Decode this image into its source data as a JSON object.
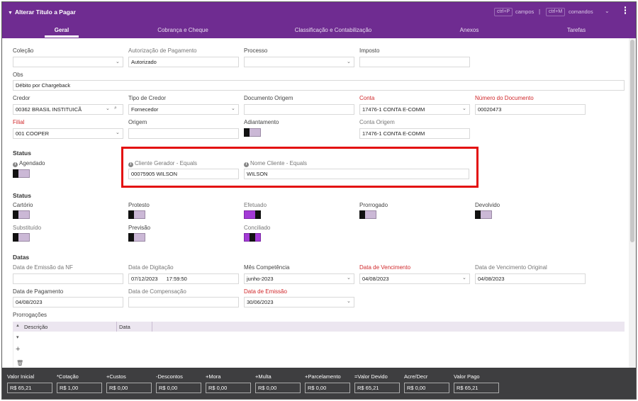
{
  "window": {
    "title": "Alterar Título a Pagar",
    "shortcut_fields_key": "ctrl+P",
    "shortcut_fields_label": "campos",
    "separator": "|",
    "shortcut_commands_key": "ctrl+M",
    "shortcut_commands_label": "comandos"
  },
  "tabs": [
    "Geral",
    "Cobrança e Cheque",
    "Classificação e Contabilização",
    "Anexos",
    "Tarefas"
  ],
  "fields": {
    "colecao": {
      "label": "Coleção",
      "value": ""
    },
    "autorizacao": {
      "label": "Autorização de Pagamento",
      "value": "Autorizado"
    },
    "processo": {
      "label": "Processo",
      "value": ""
    },
    "imposto": {
      "label": "Imposto",
      "value": ""
    },
    "obs": {
      "label": "Obs",
      "value": "Débito por Chargeback"
    },
    "credor": {
      "label": "Credor",
      "value": "00362 BRASIL INSTITUICÃ"
    },
    "tipo_credor": {
      "label": "Tipo de Credor",
      "value": "Fornecedor"
    },
    "documento_origem": {
      "label": "Documento Origem",
      "value": ""
    },
    "conta": {
      "label": "Conta",
      "value": "17476-1 CONTA E-COMM"
    },
    "numero_documento": {
      "label": "Número do Documento",
      "value": "00020473"
    },
    "filial": {
      "label": "Filial",
      "value": "001 COOPER"
    },
    "origem": {
      "label": "Origem",
      "value": ""
    },
    "adiantamento": {
      "label": "Adiantamento"
    },
    "conta_origem": {
      "label": "Conta Origem",
      "value": "17476-1 CONTA  E-COMM"
    }
  },
  "status1": {
    "title": "Status",
    "agendado": "Agendado",
    "cliente_gerador_label": "Cliente Gerador - Equals",
    "cliente_gerador_value": "00075905 WILSON",
    "nome_cliente_label": "Nome Cliente - Equals",
    "nome_cliente_value": "WILSON"
  },
  "status2": {
    "title": "Status",
    "items": [
      {
        "label": "Cartório",
        "on": false
      },
      {
        "label": "Protesto",
        "on": false
      },
      {
        "label": "Efetuado",
        "on": true
      },
      {
        "label": "Prorrogado",
        "on": false
      },
      {
        "label": "Devolvido",
        "on": false
      },
      {
        "label": "Substituído",
        "on": false
      },
      {
        "label": "Previsão",
        "on": false
      },
      {
        "label": "Conciliado",
        "on": true
      }
    ]
  },
  "datas": {
    "title": "Datas",
    "emissao_nf": {
      "label": "Data de Emissão da NF",
      "value": ""
    },
    "digitacao": {
      "label": "Data de Digitação",
      "date": "07/12/2023",
      "time": "17:59:50"
    },
    "mes_competencia": {
      "label": "Mês Competência",
      "value": "junho-2023"
    },
    "vencimento": {
      "label": "Data de Vencimento",
      "value": "04/08/2023"
    },
    "vencimento_original": {
      "label": "Data de Vencimento Original",
      "value": "04/08/2023"
    },
    "pagamento": {
      "label": "Data de Pagamento",
      "value": "04/08/2023"
    },
    "compensacao": {
      "label": "Data de Compensação",
      "value": ""
    },
    "emissao": {
      "label": "Data de Emissão",
      "value": "30/06/2023"
    }
  },
  "prorrogacoes": {
    "title": "Prorrogações",
    "columns": [
      "Descrição",
      "Data"
    ]
  },
  "totals": [
    {
      "label": "Valor Inicial",
      "value": "R$ 65,21"
    },
    {
      "label": "*Cotação",
      "value": "R$ 1,00"
    },
    {
      "label": "+Custos",
      "value": "R$ 0,00"
    },
    {
      "label": "-Descontos",
      "value": "R$ 0,00"
    },
    {
      "label": "+Mora",
      "value": "R$ 0,00"
    },
    {
      "label": "+Multa",
      "value": "R$ 0,00"
    },
    {
      "label": "+Parcelamento",
      "value": "R$ 0,00"
    },
    {
      "label": "=Valor Devido",
      "value": "R$ 65,21"
    },
    {
      "label": "Acre/Decr",
      "value": "R$ 0,00"
    },
    {
      "label": "Valor Pago",
      "value": "R$ 65,21"
    }
  ],
  "colors": {
    "header": "#6f2c91",
    "toggle_on": "#a33ad6",
    "required_label": "#d0282b",
    "highlight": "#e31010",
    "footer": "#3e3e40"
  }
}
